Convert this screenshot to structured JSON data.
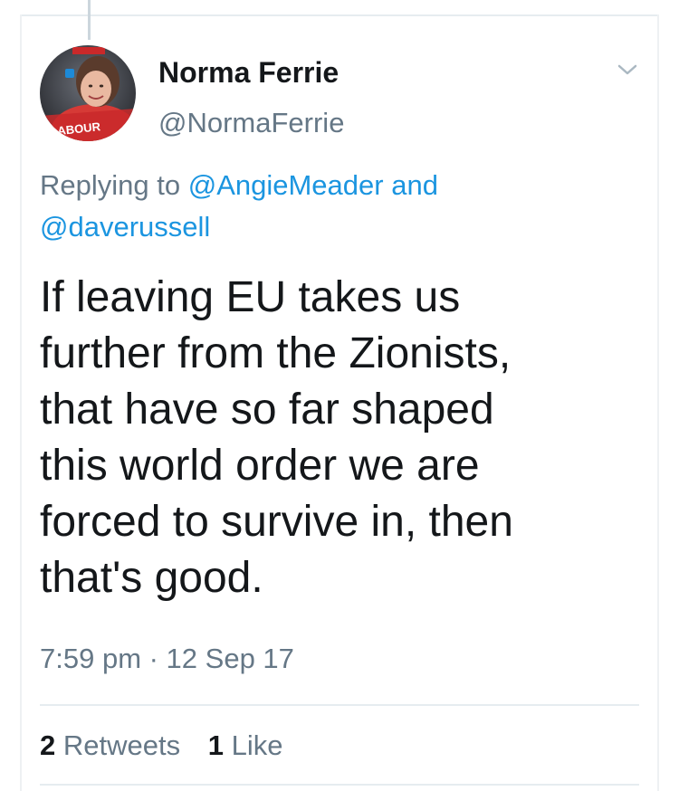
{
  "tweet": {
    "display_name": "Norma Ferrie",
    "handle": "@NormaFerrie",
    "avatar_badge": "LABOUR",
    "reply_prefix": "Replying to",
    "reply_mention_1": "@AngieMeader",
    "reply_joiner": "and",
    "reply_mention_2": "@daverussell",
    "text": "If leaving EU takes us\nfurther from the Zionists,\nthat have so far shaped\nthis world order we are\nforced to survive in, then\nthat's good.",
    "timestamp": "7:59 pm · 12 Sep 17",
    "retweet_count": "2",
    "retweet_label": "Retweets",
    "like_count": "1",
    "like_label": "Like"
  },
  "icons": {
    "menu": "chevron-down-icon"
  },
  "colors": {
    "link": "#1b95e0",
    "secondary_text": "#657786",
    "primary_text": "#14171a",
    "divider": "#e6ecf0"
  }
}
